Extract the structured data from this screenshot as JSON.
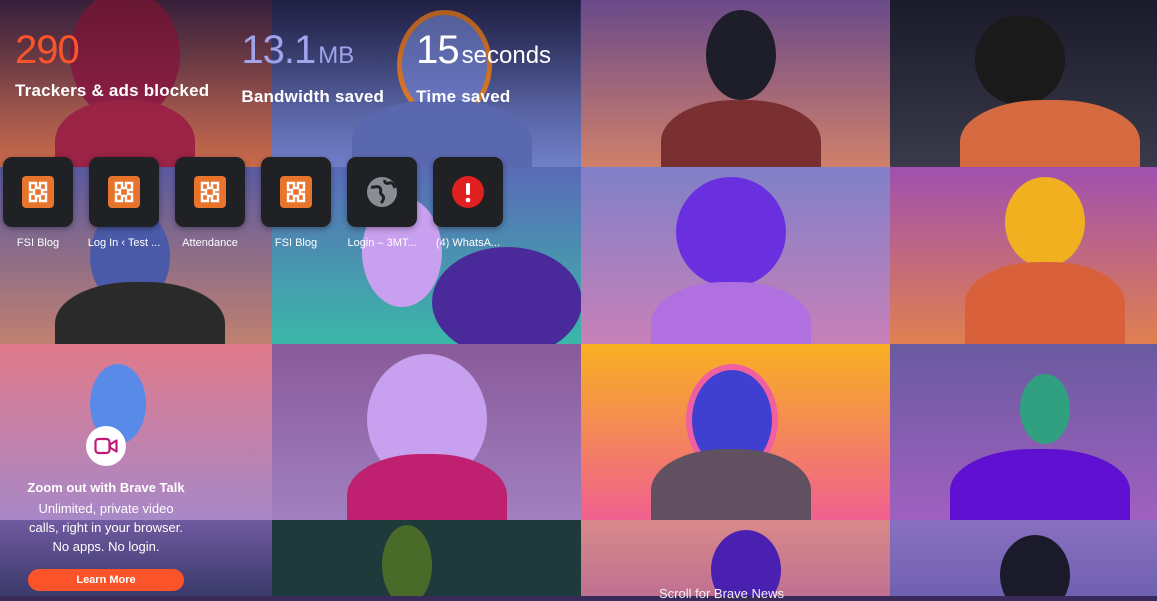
{
  "stats": {
    "trackers": {
      "value": "290",
      "label": "Trackers & ads blocked",
      "color": "#fb542b"
    },
    "bandwidth": {
      "value": "13.1",
      "unit": "MB",
      "label": "Bandwidth saved",
      "color": "#a0a5eb"
    },
    "time": {
      "value": "15",
      "unit": "seconds",
      "label": "Time saved",
      "color": "#ffffff"
    }
  },
  "top_sites": [
    {
      "name": "FSI Blog",
      "icon": "xampp-icon"
    },
    {
      "name": "Log In ‹ Test ...",
      "icon": "xampp-icon"
    },
    {
      "name": "Attendance",
      "icon": "xampp-icon"
    },
    {
      "name": "FSI Blog",
      "icon": "xampp-icon"
    },
    {
      "name": "Login – 3MT...",
      "icon": "globe-icon"
    },
    {
      "name": "(4) WhatsA...",
      "icon": "alert-icon"
    }
  ],
  "brave_talk": {
    "title": "Zoom out with Brave Talk",
    "line1": "Unlimited, private video",
    "line2": "calls, right in your browser.",
    "line3": "No apps. No login.",
    "button": "Learn More",
    "icon": "video-camera-icon"
  },
  "scroll_hint": "Scroll for Brave News",
  "colors": {
    "accent": "#fb542b",
    "xampp": "#e8732b",
    "alert": "#e02020"
  }
}
